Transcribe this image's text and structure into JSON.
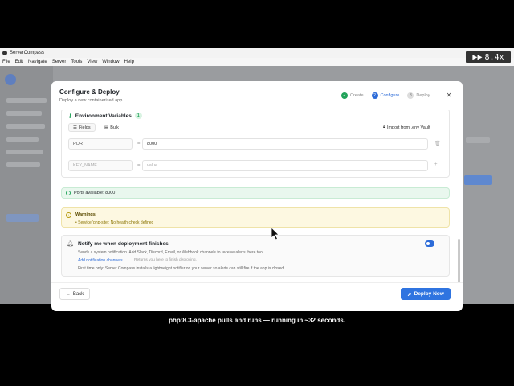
{
  "window": {
    "title": "ServerCompass"
  },
  "menubar": [
    "File",
    "Edit",
    "Navigate",
    "Server",
    "Tools",
    "View",
    "Window",
    "Help"
  ],
  "speed_badge": {
    "label": "8.4x"
  },
  "modal": {
    "title": "Configure & Deploy",
    "subtitle": "Deploy a new containerized app",
    "steps": [
      {
        "label": "Create",
        "status": "done",
        "marker": "✓"
      },
      {
        "label": "Configure",
        "status": "active",
        "marker": "2"
      },
      {
        "label": "Deploy",
        "status": "pending",
        "marker": "3"
      }
    ]
  },
  "env": {
    "title": "Environment Variables",
    "count": "1",
    "tabs": {
      "fields": "Fields",
      "bulk": "Bulk"
    },
    "import_label": "Import from .env Vault",
    "rows": [
      {
        "key": "PORT",
        "value": "8000"
      }
    ],
    "new_row": {
      "key_placeholder": "KEY_NAME",
      "value_placeholder": "value"
    }
  },
  "ports": {
    "text": "Ports available: 8000"
  },
  "warnings": {
    "title": "Warnings",
    "items": [
      "• Service 'php-site': No health check defined"
    ]
  },
  "notify": {
    "title": "Notify me when deployment finishes",
    "description": "Sends a system notification. Add Slack, Discord, Email, or Webhook channels to receive alerts there too.",
    "link": "Add notification channels",
    "hint": "Returns you here to finish deploying.",
    "note": "First time only: Server Compass installs a lightweight notifier on your server so alerts can still fire if the app is closed.",
    "enabled": true
  },
  "footer": {
    "back_label": "Back",
    "deploy_label": "Deploy Now"
  },
  "caption": "php:8.3-apache pulls and runs — running in ~32 seconds.",
  "colors": {
    "accent": "#2f74e0",
    "success": "#22a35a",
    "warning_bg": "#fdf8e1"
  }
}
